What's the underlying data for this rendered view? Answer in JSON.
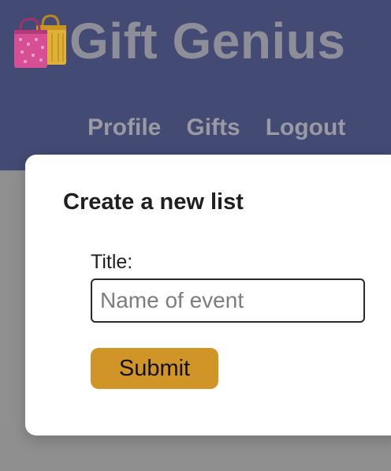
{
  "header": {
    "logo_icon": "shopping-bags-icon",
    "title": "Gift Genius",
    "nav": [
      {
        "label": "Profile"
      },
      {
        "label": "Gifts"
      },
      {
        "label": "Logout"
      }
    ]
  },
  "card": {
    "title": "Create a new list",
    "form": {
      "title_label": "Title:",
      "title_placeholder": "Name of event",
      "title_value": "",
      "submit_label": "Submit"
    }
  },
  "colors": {
    "header_bg": "#434a73",
    "page_bg": "#8f8f8f",
    "accent": "#d09526"
  }
}
